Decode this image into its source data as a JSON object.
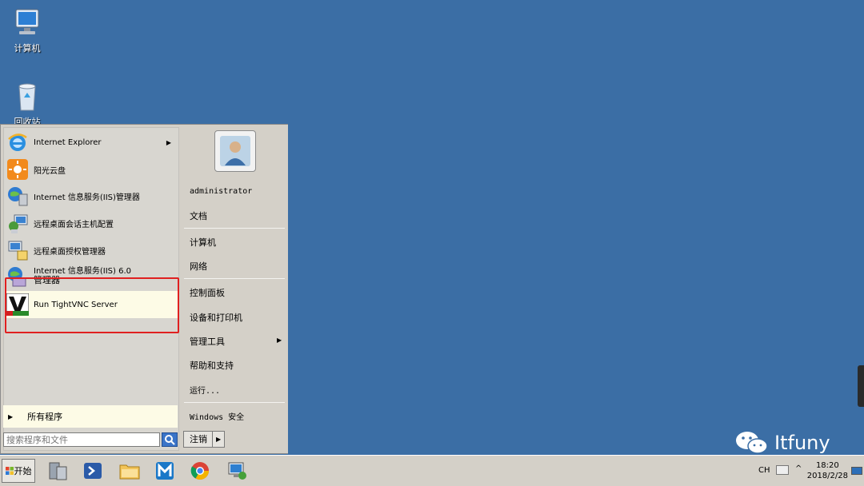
{
  "desktop": {
    "computer_label": "计算机",
    "recycle_label": "回收站"
  },
  "start_menu": {
    "programs": [
      {
        "label": "Internet Explorer",
        "has_submenu": true,
        "icon": "ie-icon"
      },
      {
        "label": "阳光云盘",
        "has_submenu": false,
        "icon": "sun-cloud-icon"
      },
      {
        "label": "Internet 信息服务(IIS)管理器",
        "has_submenu": false,
        "icon": "iis-icon"
      },
      {
        "label": "远程桌面会话主机配置",
        "has_submenu": false,
        "icon": "rdp-config-icon"
      },
      {
        "label": "远程桌面授权管理器",
        "has_submenu": false,
        "icon": "rdp-license-icon"
      },
      {
        "label": "Internet 信息服务(IIS) 6.0",
        "label2": "管理器",
        "has_submenu": false,
        "icon": "iis6-icon"
      },
      {
        "label": "Run TightVNC Server",
        "has_submenu": false,
        "icon": "tightvnc-icon",
        "highlighted": true
      }
    ],
    "all_programs": "所有程序",
    "search_placeholder": "搜索程序和文件",
    "right": {
      "user": "administrator",
      "documents": "文档",
      "computer": "计算机",
      "network": "网络",
      "control_panel": "控制面板",
      "devices_printers": "设备和打印机",
      "admin_tools": "管理工具",
      "help": "帮助和支持",
      "run": "运行...",
      "windows_security": "Windows 安全"
    },
    "logout": "注销"
  },
  "taskbar": {
    "start": "开始",
    "tray_lang": "CH",
    "time": "18:20",
    "date": "2018/2/28"
  },
  "watermark": "Itfuny",
  "colors": {
    "desktop": "#3b6ea5",
    "highlight_box": "#e02020"
  }
}
